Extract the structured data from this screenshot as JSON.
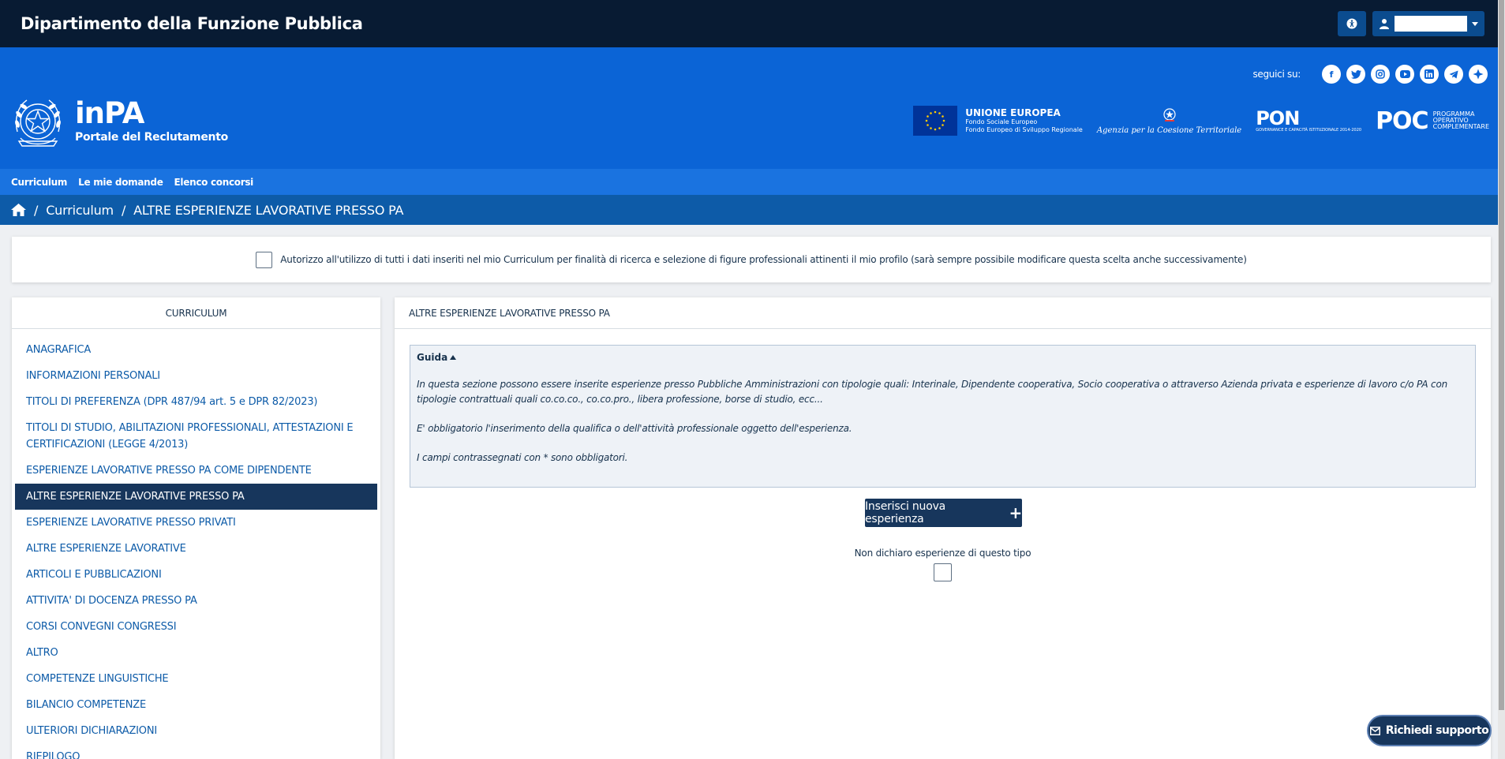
{
  "topbar": {
    "department": "Dipartimento della Funzione Pubblica",
    "accessibility_icon": "accessibility-icon",
    "user_icon": "user-icon"
  },
  "header": {
    "brand_name": "inPA",
    "brand_sub": "Portale del Reclutamento",
    "social_label": "seguici su:",
    "social_icons": [
      "facebook-icon",
      "twitter-icon",
      "instagram-icon",
      "youtube-icon",
      "linkedin-icon",
      "telegram-icon",
      "spaces-icon"
    ],
    "eu_title": "UNIONE EUROPEA",
    "eu_line1": "Fondo Sociale Europeo",
    "eu_line2": "Fondo Europeo di Sviluppo Regionale",
    "agency": "Agenzia per la Coesione Territoriale",
    "pon_big": "PON",
    "pon_small": "GOVERNANCE E CAPACITÀ ISTITUZIONALE 2014-2020",
    "poc_big": "POC",
    "poc_small_1": "PROGRAMMA",
    "poc_small_2": "OPERATIVO",
    "poc_small_3": "COMPLEMENTARE"
  },
  "nav": {
    "items": [
      "Curriculum",
      "Le mie domande",
      "Elenco concorsi"
    ]
  },
  "breadcrumb": {
    "sep": "/",
    "items": [
      "Curriculum",
      "ALTRE ESPERIENZE LAVORATIVE PRESSO PA"
    ]
  },
  "consent": {
    "text": "Autorizzo all'utilizzo di tutti i dati inseriti nel mio Curriculum per finalità di ricerca e selezione di figure professionali attinenti il mio profilo (sarà sempre possibile modificare questa scelta anche successivamente)"
  },
  "sidebar": {
    "title": "CURRICULUM",
    "items": [
      "ANAGRAFICA",
      "INFORMAZIONI PERSONALI",
      "TITOLI DI PREFERENZA (DPR 487/94 art. 5 e DPR 82/2023)",
      "TITOLI DI STUDIO, ABILITAZIONI PROFESSIONALI, ATTESTAZIONI E CERTIFICAZIONI (LEGGE 4/2013)",
      "ESPERIENZE LAVORATIVE PRESSO PA COME DIPENDENTE",
      "ALTRE ESPERIENZE LAVORATIVE PRESSO PA",
      "ESPERIENZE LAVORATIVE PRESSO PRIVATI",
      "ALTRE ESPERIENZE LAVORATIVE",
      "ARTICOLI E PUBBLICAZIONI",
      "ATTIVITA' DI DOCENZA PRESSO PA",
      "CORSI CONVEGNI CONGRESSI",
      "ALTRO",
      "COMPETENZE LINGUISTICHE",
      "BILANCIO COMPETENZE",
      "ULTERIORI DICHIARAZIONI",
      "RIEPILOGO"
    ],
    "active_index": 5
  },
  "main": {
    "title": "ALTRE ESPERIENZE LAVORATIVE PRESSO PA",
    "guide_title": "Guida",
    "guide_p1": "In questa sezione possono essere inserite esperienze presso Pubbliche Amministrazioni con tipologie quali: Interinale, Dipendente cooperativa, Socio cooperativa o attraverso Azienda privata e esperienze di lavoro c/o PA con tipologie contrattuali quali co.co.co., co.co.pro., libera professione, borse di studio, ecc...",
    "guide_p2": "E' obbligatorio l'inserimento della qualifica o dell'attività professionale oggetto dell'esperienza.",
    "guide_p3": "I campi contrassegnati con * sono obbligatori.",
    "add_button": "Inserisci nuova esperienza",
    "no_declare": "Non dichiaro esperienze di questo tipo"
  },
  "support": {
    "label": "Richiedi supporto"
  }
}
